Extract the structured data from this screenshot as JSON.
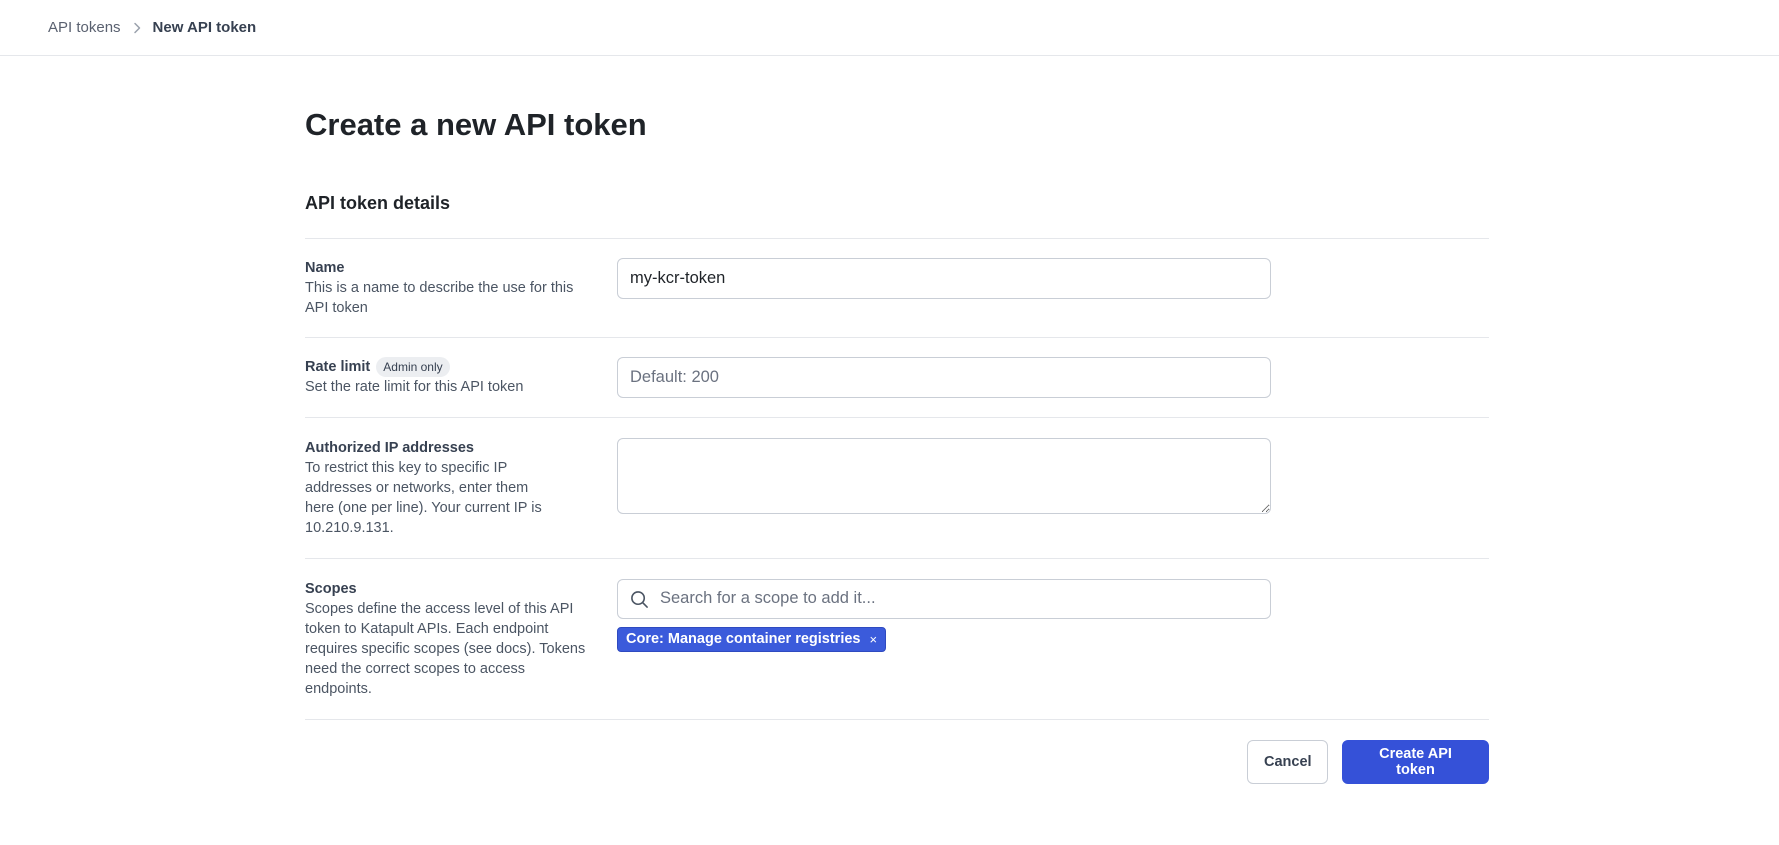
{
  "breadcrumb": {
    "parent": "API tokens",
    "current": "New API token"
  },
  "page": {
    "title": "Create a new API token",
    "section_title": "API token details"
  },
  "fields": {
    "name": {
      "label": "Name",
      "description": "This is a name to describe the use for this API token",
      "value": "my-kcr-token"
    },
    "rate_limit": {
      "label": "Rate limit",
      "badge": "Admin only",
      "description": "Set the rate limit for this API token",
      "placeholder": "Default: 200"
    },
    "authorized_ips": {
      "label": "Authorized IP addresses",
      "description": "To restrict this key to specific IP addresses or networks, enter them here (one per line). Your current IP is 10.210.9.131.",
      "value": ""
    },
    "scopes": {
      "label": "Scopes",
      "description": "Scopes define the access level of this API token to Katapult APIs. Each endpoint requires specific scopes (see docs). Tokens need the correct scopes to access endpoints.",
      "search_placeholder": "Search for a scope to add it...",
      "selected": [
        {
          "label": "Core: Manage container registries",
          "remove": "×"
        }
      ]
    }
  },
  "actions": {
    "cancel": "Cancel",
    "submit": "Create API token"
  },
  "colors": {
    "primary": "#3551d8",
    "tag": "#3b5bdb"
  }
}
